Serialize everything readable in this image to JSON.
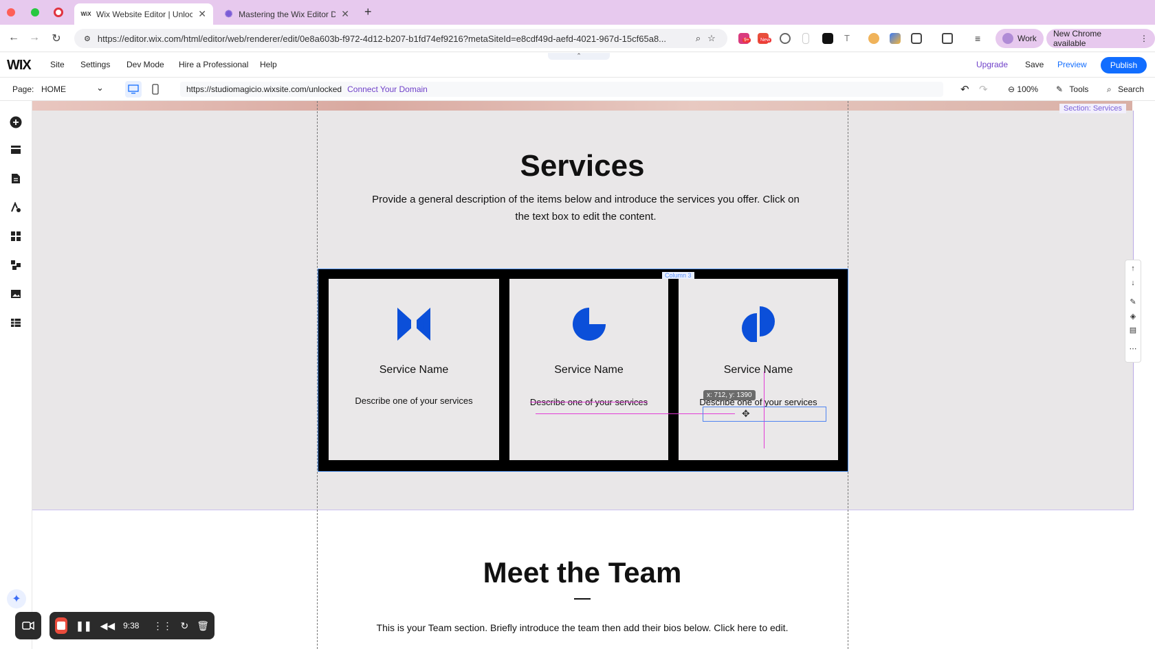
{
  "browser": {
    "tabs": [
      {
        "title": "Wix Website Editor | Unlocked",
        "favicon": "WiX",
        "active": true
      },
      {
        "title": "Mastering the Wix Editor Dashboard",
        "favicon": "gear",
        "active": false
      }
    ],
    "new_tab": "+",
    "url": "https://editor.wix.com/html/editor/web/renderer/edit/0e8a603b-f972-4d12-b207-b1fd74ef9216?metaSiteId=e8cdf49d-aefd-4021-967d-15cf65a8...",
    "profile": "Work",
    "update_label": "New Chrome available",
    "ext_badge_1": "9+",
    "ext_badge_2": "New"
  },
  "wix_top": {
    "logo": "WIX",
    "menu": [
      "Site",
      "Settings",
      "Dev Mode",
      "Hire a Professional",
      "Help"
    ],
    "upgrade": "Upgrade",
    "save": "Save",
    "preview": "Preview",
    "publish": "Publish",
    "collapse": "⌃"
  },
  "pagebar": {
    "page_label": "Page:",
    "page_value": "HOME",
    "site_url": "https://studiomagicio.wixsite.com/unlocked",
    "connect_domain": "Connect Your Domain",
    "zoom": "100%",
    "tools": "Tools",
    "search": "Search"
  },
  "canvas": {
    "section_label": "Section: Services",
    "services_title": "Services",
    "services_desc": "Provide a general description of the items below and introduce the services you offer. Click on the text box to edit the content.",
    "column_label": "Column 3",
    "cards": [
      {
        "name": "Service Name",
        "desc": "Describe one of your services"
      },
      {
        "name": "Service Name",
        "desc": "Describe one of your services"
      },
      {
        "name": "Service Name",
        "desc": "Describe one of your services"
      }
    ],
    "coord_tooltip": "x: 712, y: 1390",
    "team_title": "Meet the Team",
    "team_desc": "This is your Team section. Briefly introduce the team then add their bios below. Click here to edit."
  },
  "recorder": {
    "time": "9:38"
  },
  "colors": {
    "accent_blue": "#116dff",
    "brand_purple": "#6f40c9",
    "icon_blue": "#0b4fd9",
    "guide_magenta": "#e23bd6"
  }
}
